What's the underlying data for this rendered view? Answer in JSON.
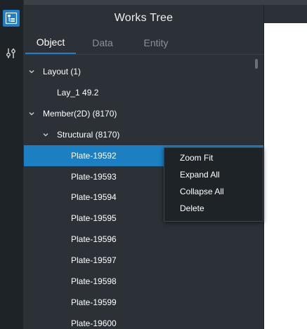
{
  "panel": {
    "title": "Works Tree"
  },
  "tabs": [
    {
      "label": "Object",
      "active": true
    },
    {
      "label": "Data",
      "active": false
    },
    {
      "label": "Entity",
      "active": false
    }
  ],
  "toolstrip": {
    "items": [
      {
        "icon": "works-tree-icon",
        "active": true
      },
      {
        "icon": "sliders-icon",
        "active": false
      }
    ]
  },
  "tree": {
    "rows": [
      {
        "label": "Layout (1)",
        "expanded": true
      },
      {
        "label": "Lay_1 49.2"
      },
      {
        "label": "Member(2D) (8170)",
        "expanded": true
      },
      {
        "label": "Structural (8170)",
        "expanded": true
      },
      {
        "label": "Plate-19592",
        "selected": true
      },
      {
        "label": "Plate-19593"
      },
      {
        "label": "Plate-19594"
      },
      {
        "label": "Plate-19595"
      },
      {
        "label": "Plate-19596"
      },
      {
        "label": "Plate-19597"
      },
      {
        "label": "Plate-19598"
      },
      {
        "label": "Plate-19599"
      },
      {
        "label": "Plate-19600"
      }
    ]
  },
  "context_menu": {
    "items": [
      "Zoom Fit",
      "Expand All",
      "Collapse All",
      "Delete"
    ]
  },
  "colors": {
    "accent": "#1b7fc1",
    "panel_bg": "#2b3137",
    "toolstrip_bg": "#1e2328",
    "menu_bg": "#1e2328"
  }
}
